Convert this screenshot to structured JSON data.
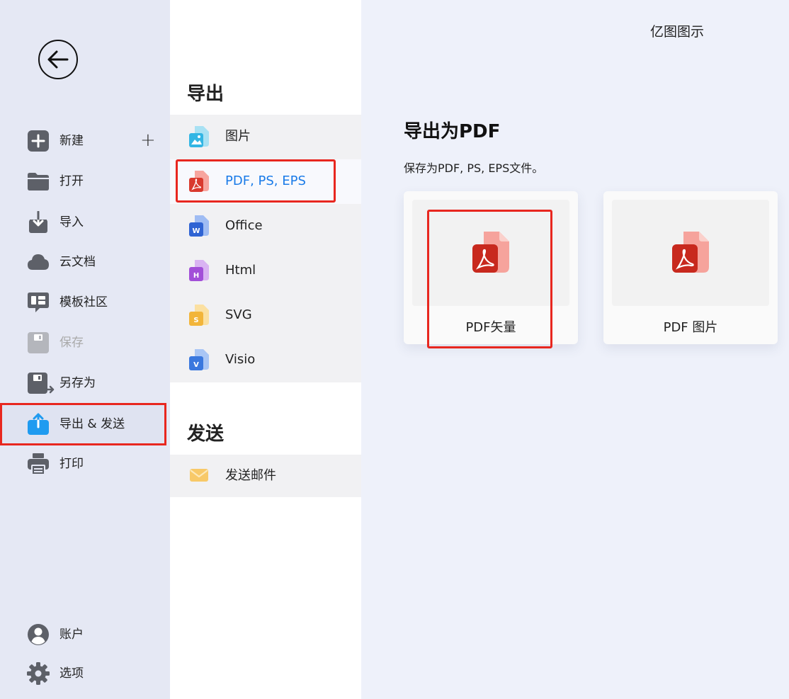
{
  "app": {
    "title": "亿图图示"
  },
  "sidebar": {
    "items": [
      {
        "label": "新建",
        "icon": "plus-square-icon"
      },
      {
        "label": "打开",
        "icon": "folder-icon"
      },
      {
        "label": "导入",
        "icon": "import-icon"
      },
      {
        "label": "云文档",
        "icon": "cloud-icon"
      },
      {
        "label": "模板社区",
        "icon": "template-community-icon"
      },
      {
        "label": "保存",
        "icon": "save-icon",
        "disabled": true
      },
      {
        "label": "另存为",
        "icon": "save-as-icon"
      },
      {
        "label": "导出 & 发送",
        "icon": "export-icon",
        "selected": true
      },
      {
        "label": "打印",
        "icon": "printer-icon"
      },
      {
        "label": "账户",
        "icon": "account-icon"
      },
      {
        "label": "选项",
        "icon": "gear-icon"
      }
    ]
  },
  "export_panel": {
    "heading": "导出",
    "items": [
      {
        "label": "图片",
        "icon": "image-file-icon"
      },
      {
        "label": "PDF, PS, EPS",
        "icon": "pdf-file-icon",
        "active": true
      },
      {
        "label": "Office",
        "icon": "word-file-icon"
      },
      {
        "label": "Html",
        "icon": "html-file-icon"
      },
      {
        "label": "SVG",
        "icon": "svg-file-icon"
      },
      {
        "label": "Visio",
        "icon": "visio-file-icon"
      }
    ]
  },
  "send_panel": {
    "heading": "发送",
    "items": [
      {
        "label": "发送邮件",
        "icon": "mail-icon"
      }
    ]
  },
  "content": {
    "title": "导出为PDF",
    "description": "保存为PDF, PS, EPS文件。",
    "cards": [
      {
        "label": "PDF矢量",
        "icon": "pdf-icon"
      },
      {
        "label": "PDF 图片",
        "icon": "pdf-icon"
      }
    ]
  },
  "colors": {
    "accent": "#1a7be8",
    "highlight": "#e8271f",
    "sidebar_bg": "#e5e8f4",
    "content_bg": "#eef1fa"
  }
}
